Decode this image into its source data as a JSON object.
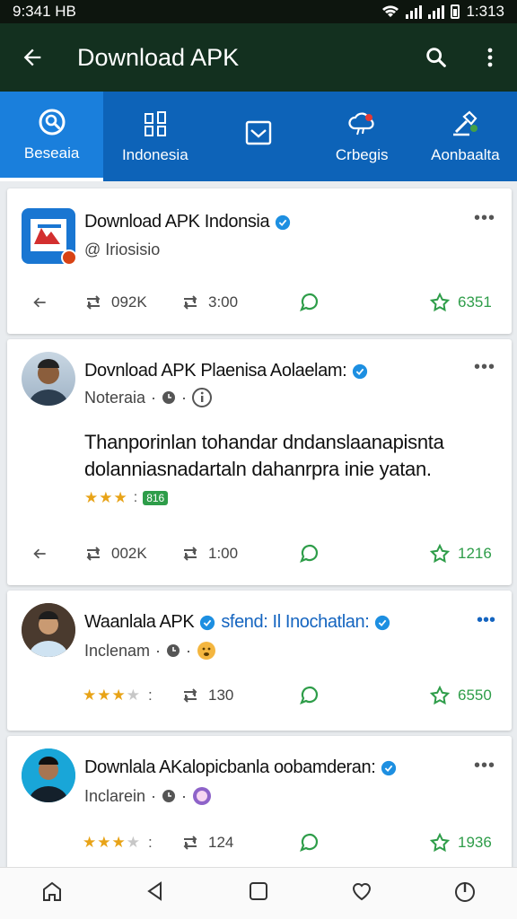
{
  "status_bar": {
    "time": "9:341 HB",
    "clock": "1:313"
  },
  "app_bar": {
    "title": "Download APK"
  },
  "tabs": [
    {
      "label": "Beseaia",
      "icon": "search-circle-icon"
    },
    {
      "label": "Indonesia",
      "icon": "grid-icon"
    },
    {
      "label": "",
      "icon": "inbox-icon"
    },
    {
      "label": "Crbegis",
      "icon": "cloud-alert-icon"
    },
    {
      "label": "Aonbaalta",
      "icon": "hammer-icon"
    }
  ],
  "posts": [
    {
      "title": "Download APK Indonsia",
      "subtitle": "@ Iriosisio",
      "actions": {
        "retweets": "092K",
        "replies": "3:00",
        "likes": "6351"
      }
    },
    {
      "title": "Dovnload APK Plaenisa Aolaelam:",
      "subtitle": "Noteraia",
      "body": "Thanporinlan tohandar dndanslaanapisnta dolanniasnadartaln dahanrpra inie yatan.",
      "tag": "816",
      "actions": {
        "retweets": "002K",
        "replies": "1:00",
        "likes": "1216"
      }
    },
    {
      "title": "Waanlala APK",
      "title_link": "sfend: Il Inochatlan:",
      "subtitle": "Inclenam",
      "actions": {
        "replies": "130",
        "likes": "6550"
      }
    },
    {
      "title": "Downlala AKalopicbanla oobamderan:",
      "subtitle": "Inclarein",
      "actions": {
        "replies": "124",
        "likes": "1936"
      }
    }
  ],
  "colors": {
    "tab_bg": "#0d63b8",
    "appbar": "#13301f",
    "verified": "#1d8fe1",
    "like_green": "#2e9d49",
    "star": "#e8a317"
  }
}
